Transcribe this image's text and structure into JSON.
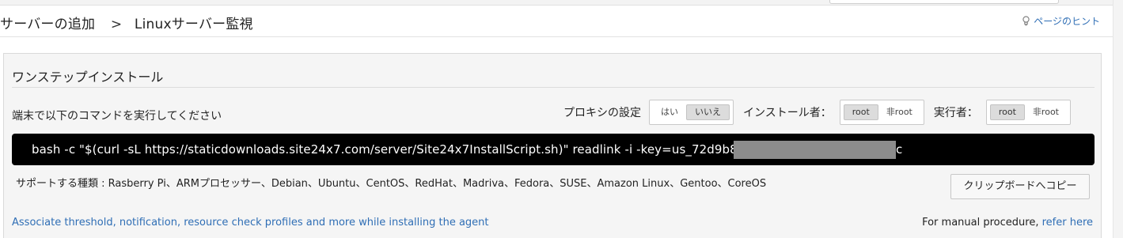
{
  "breadcrumb": {
    "parent": "サーバーの追加",
    "separator": ">",
    "current": "Linuxサーバー監視"
  },
  "hint": {
    "label": "ページのヒント",
    "icon": "lightbulb-icon"
  },
  "panel": {
    "title": "ワンステップインストール",
    "instruction": "端末で以下のコマンドを実行してください",
    "proxy": {
      "label": "プロキシの設定",
      "options": [
        "はい",
        "いいえ"
      ],
      "selected": "いいえ"
    },
    "installer": {
      "label": "インストール者：",
      "options": [
        "root",
        "非root"
      ],
      "selected": "root"
    },
    "executor": {
      "label": "実行者：",
      "options": [
        "root",
        "非root"
      ],
      "selected": "root"
    },
    "command": {
      "visible": "bash -c \"$(curl -sL https://staticdownloads.site24x7.com/server/Site24x7InstallScript.sh)\" readlink -i -key=us_72d9b8acf0",
      "tail": "c"
    },
    "supported": "サポートする種類 : Rasberry Pi、ARMプロセッサー、Debian、Ubuntu、CentOS、RedHat、Madriva、Fedora、SUSE、Amazon Linux、Gentoo、CoreOS",
    "copy_button": "クリップボードへコピー",
    "associate_link": "Associate threshold, notification, resource check profiles and more while installing the agent",
    "manual": {
      "prefix": "For manual procedure, ",
      "link": "refer here"
    }
  },
  "colors": {
    "link": "#2f6eb5",
    "command_bg": "#000000",
    "panel_bg": "#f5f5f5"
  }
}
